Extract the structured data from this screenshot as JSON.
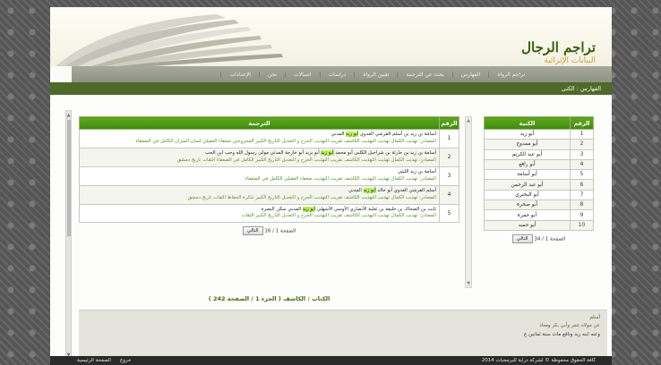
{
  "header": {
    "logo_title": "تراجم الرجال",
    "logo_subtitle": "البيانات الإثرائية"
  },
  "nav": {
    "items": [
      "تراجم الرواة",
      "الفهارس",
      "بحث عن الترجمة",
      "تعيين الرواة",
      "دراسات",
      "اتصالات",
      "نحن",
      "الإعدادات"
    ]
  },
  "breadcrumb": "الفهارس : الكنى",
  "main_table": {
    "col_num": "الرقم",
    "col_translation": "الترجمة",
    "rows": [
      {
        "num": "1",
        "name_before": "أسامة بن زيد بن أسلم القرشي العدوي ",
        "kunya": "أبو زيد",
        "name_after": " المدني",
        "sources": "المصادر: تهذيب الكمال تهذيب التهذيب الكاشف تقريب التهذيب الجرح و التعديل التاريخ الكبير المجروحين ضعفاء العقيلي لسان الميزان الكامل في الضعفاء"
      },
      {
        "num": "2",
        "name_before": "أسامة بن زيد بن حارثة بن شراحيل الكلبي أبو محمد ",
        "kunya": "أبو زيد",
        "name_after": " أبو يزيد أبو خارجة المدني مولى رسول الله وحب ابن الحب",
        "sources": "المصادر: تهذيب الكمال تهذيب التهذيب الكاشف تقريب التهذيب الجرح و التعديل التاريخ الكبير الكامل في الضعفاء الثقات تاريخ دمشق"
      },
      {
        "num": "3",
        "name_before": "أسامة بن زيد الليثي",
        "kunya": "",
        "name_after": "",
        "sources": "المصادر: تهذيب الكمال تهذيب التهذيب الكاشف تقريب التهذيب ضعفاء العقيلي الكامل في الضعفاء"
      },
      {
        "num": "4",
        "name_before": "أسلم القرشي العدوي أبو خالد ",
        "kunya": "أبو زيد",
        "name_after": " المدني",
        "sources": "المصادر: تهذيب الكمال تهذيب التهذيب الكاشف تقريب التهذيب الجرح و التعديل التاريخ الكبير تذكرة الحفاظ الثقات تاريخ دمشق"
      },
      {
        "num": "5",
        "name_before": "ثابت بن الضحاك بن خليفة بن ثعلبة الأنصاري الأوسي الأشهلي ",
        "kunya": "أبو زيد",
        "name_after": " المدني سكن البصرة",
        "sources": "المصادر: تهذيب الكمال تهذيب التهذيب الكاشف تقريب التهذيب الجرح و التعديل التاريخ الكبير الثقات"
      }
    ],
    "pager_text": "الصفحة 1 / 16",
    "next_label": "التالي"
  },
  "side_table": {
    "col_num": "الرقم",
    "col_kunya": "الكنية",
    "rows": [
      {
        "num": "1",
        "kunya": "أبو زيد"
      },
      {
        "num": "2",
        "kunya": "أبو ممدوح"
      },
      {
        "num": "3",
        "kunya": "أبو عبد الكريم"
      },
      {
        "num": "4",
        "kunya": "أبو رافع"
      },
      {
        "num": "5",
        "kunya": "أبو أسامة"
      },
      {
        "num": "6",
        "kunya": "أبو عبد الرحمن"
      },
      {
        "num": "7",
        "kunya": "أبو البختري"
      },
      {
        "num": "8",
        "kunya": "أبو صخرة"
      },
      {
        "num": "9",
        "kunya": "أبو حمزة"
      },
      {
        "num": "10",
        "kunya": "أبو حميد"
      }
    ],
    "pager_text": "الصفحة 1 / 34",
    "next_label": "التالي"
  },
  "book_line": "الكتاب : الكاشف ( الجزء 1 / الصفحة 242 )",
  "bio": {
    "name": "أسلم",
    "line1": "عن مولاه عمر وأبي بكر ومعاذ",
    "line2": "وعنه ابنه زيد وناقع مات سنة ثمانين ع"
  },
  "footer": {
    "copyright": "كافة الحقوق محفوظة © لشركة دراية للبرمجيات 2014",
    "logout": "خروج",
    "home": "الصفحة الرئيسية"
  }
}
